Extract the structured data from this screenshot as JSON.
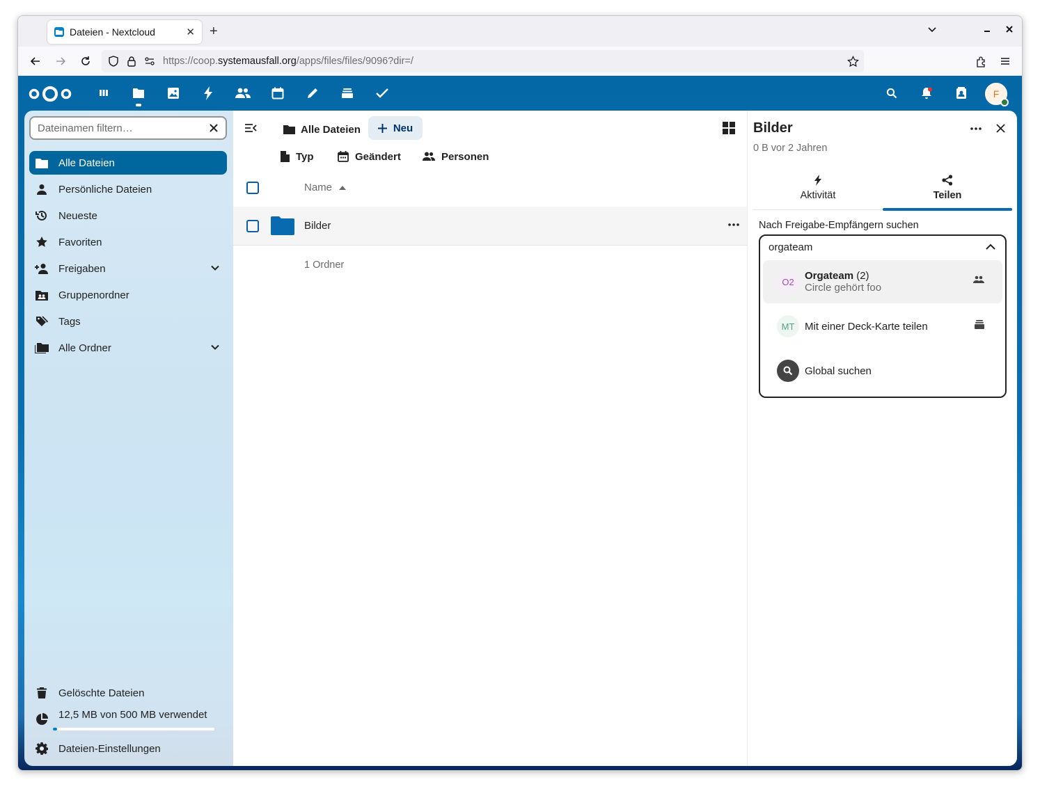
{
  "browser": {
    "tab_title": "Dateien - Nextcloud",
    "url_prefix": "https://coop.",
    "url_host": "systemausfall.org",
    "url_path": "/apps/files/files/9096?dir=/",
    "icons": [
      "back-icon",
      "forward-icon",
      "reload-icon",
      "shield-icon",
      "lock-icon",
      "permissions-icon",
      "star-icon",
      "extensions-icon",
      "menu-icon"
    ]
  },
  "header": {
    "apps": [
      "dashboard",
      "files",
      "photos",
      "activity",
      "contacts",
      "calendar",
      "notes",
      "deck",
      "tasks"
    ],
    "active_app": "files",
    "avatar_initial": "F",
    "colors": {
      "primary": "#0082c9",
      "header": "#0568a6"
    }
  },
  "sidebar": {
    "filter_placeholder": "Dateinamen filtern…",
    "items": [
      {
        "label": "Alle Dateien",
        "active": true
      },
      {
        "label": "Persönliche Dateien"
      },
      {
        "label": "Neueste"
      },
      {
        "label": "Favoriten"
      },
      {
        "label": "Freigaben",
        "expandable": true
      },
      {
        "label": "Gruppenordner"
      },
      {
        "label": "Tags"
      },
      {
        "label": "Alle Ordner",
        "expandable": true
      }
    ],
    "trash_label": "Gelöschte Dateien",
    "quota_label": "12,5 MB von 500 MB verwendet",
    "quota_fraction": 0.025,
    "settings_label": "Dateien-Einstellungen"
  },
  "main": {
    "breadcrumb": "Alle Dateien",
    "new_label": "Neu",
    "filters": [
      "Typ",
      "Geändert",
      "Personen"
    ],
    "column_name": "Name",
    "rows": [
      {
        "name": "Bilder",
        "type": "folder"
      }
    ],
    "summary": "1 Ordner"
  },
  "details": {
    "title": "Bilder",
    "subtitle": "0 B vor 2 Jahren",
    "tabs": [
      {
        "label": "Aktivität"
      },
      {
        "label": "Teilen",
        "active": true
      }
    ],
    "search_label": "Nach Freigabe-Empfängern suchen",
    "search_value": "orgateam",
    "options": [
      {
        "avatar": "O2",
        "name": "Orgateam",
        "count": "(2)",
        "sub": "Circle gehört foo",
        "icon": "group-icon"
      },
      {
        "avatar": "MT",
        "name": "Mit einer Deck-Karte teilen",
        "icon": "deck-icon"
      },
      {
        "name": "Global suchen",
        "icon": "search-icon"
      }
    ]
  }
}
